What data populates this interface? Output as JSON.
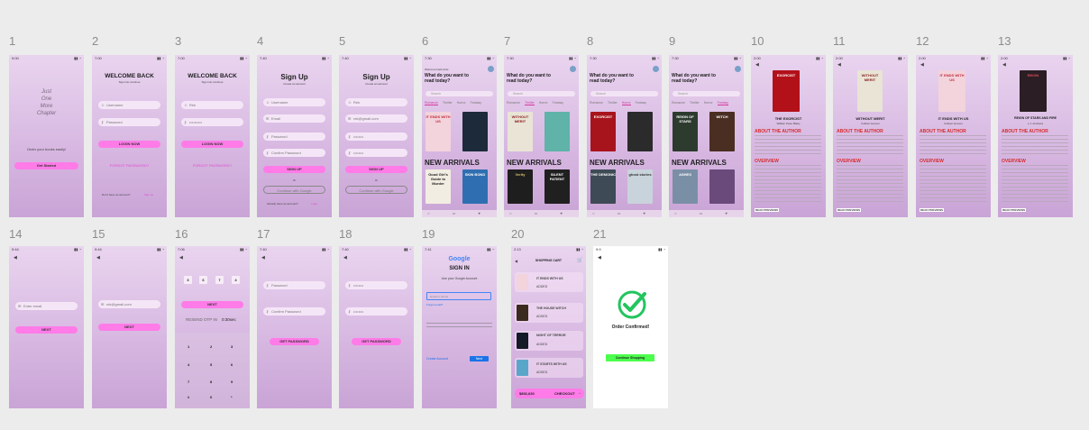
{
  "screens": [
    {
      "num": "1",
      "time": "9:00",
      "tagline": [
        "Just",
        "One",
        "More",
        "Chapter"
      ],
      "prompt": "Order your books easily!",
      "cta": "Get Started"
    },
    {
      "num": "2",
      "time": "7:00",
      "title": "WELCOME BACK",
      "subtitle": "Sign into continue",
      "user_ph": "Username",
      "pass_ph": "Password",
      "login": "LOGIN NOW",
      "forgot": "FORGOT PASSWORD?",
      "signup_q": "Don't have an account?",
      "signup_link": "Sign up"
    },
    {
      "num": "3",
      "time": "7:00",
      "title": "WELCOME BACK",
      "subtitle": "Sign into continue",
      "user_val": "Rek",
      "pass_val": "••••••••••",
      "login": "LOGIN NOW",
      "forgot": "FORGOT PASSWORD?"
    },
    {
      "num": "4",
      "time": "7:40",
      "title": "Sign Up",
      "subtitle": "Create an account",
      "f1": "Username",
      "f2": "Email",
      "f3": "Password",
      "f4": "Confirm Password",
      "signup": "SIGN UP",
      "or": "Or",
      "google": "Continue with Google",
      "have": "Already have an account?",
      "login_link": "Login"
    },
    {
      "num": "5",
      "time": "7:40",
      "title": "Sign Up",
      "subtitle": "Create an account",
      "f1": "Rek",
      "f2": "rek@gmail.com",
      "f3": "••••••••",
      "f4": "••••••••",
      "signup": "SIGN UP",
      "or": "Or",
      "google": "Continue with Google"
    },
    {
      "num": "6",
      "time": "7:30",
      "welcome": "Welcome back Ariel",
      "q1": "What do you want to",
      "q2": "read today?",
      "search": "Search",
      "tabs": [
        "Romance",
        "Thriller",
        "Horror",
        "Fantasy"
      ],
      "new_arrivals": "NEW ARRIVALS"
    },
    {
      "num": "7",
      "time": "7:30",
      "q1": "What do you want to",
      "q2": "read today?",
      "search": "Search",
      "tabs": [
        "Romance",
        "Thriller",
        "Horror",
        "Fantasy"
      ],
      "new_arrivals": "NEW ARRIVALS"
    },
    {
      "num": "8",
      "time": "7:30",
      "q1": "What do you want to",
      "q2": "read today?",
      "search": "Search",
      "tabs": [
        "Romance",
        "Thriller",
        "Horror",
        "Fantasy"
      ],
      "new_arrivals": "NEW ARRIVALS"
    },
    {
      "num": "9",
      "time": "7:30",
      "q1": "What do you want to",
      "q2": "read today?",
      "search": "Search",
      "tabs": [
        "Romance",
        "Thriller",
        "Horror",
        "Fantasy"
      ],
      "new_arrivals": "NEW ARRIVALS"
    },
    {
      "num": "10",
      "time": "2:00",
      "book_title": "THE EXORCIST",
      "author": "William Peter Blatty",
      "about": "ABOUT THE AUTHOR",
      "overview": "OVERVIEW",
      "read": "READ PREVIEWS"
    },
    {
      "num": "11",
      "time": "2:00",
      "book_title": "WITHOUT MERIT",
      "author": "Colleen Hoover",
      "about": "ABOUT THE AUTHOR",
      "overview": "OVERVIEW",
      "read": "READ PREVIEWS"
    },
    {
      "num": "12",
      "time": "2:00",
      "book_title": "IT ENDS WITH US",
      "author": "Colleen Hoover",
      "about": "ABOUT THE AUTHOR",
      "overview": "OVERVIEW",
      "read": "READ PREVIEWS"
    },
    {
      "num": "13",
      "time": "2:00",
      "book_title": "REIGN OF STARS AND FIRE",
      "author": "L.J. Andrews",
      "about": "ABOUT THE AUTHOR",
      "overview": "OVERVIEW",
      "read": "READ PREVIEWS"
    },
    {
      "num": "14",
      "time": "9:44",
      "field": "Enter email",
      "next": "NEXT"
    },
    {
      "num": "15",
      "time": "9:44",
      "field": "rek@gmail.com",
      "next": "NEXT"
    },
    {
      "num": "16",
      "time": "7:06",
      "digits": [
        "3",
        "6",
        "7",
        "4"
      ],
      "next": "NEXT",
      "resend": "RESEND OTP IN",
      "timer": "0:30sec",
      "keys": [
        "1",
        "2",
        "3",
        "4",
        "5",
        "6",
        "7",
        "8",
        "9",
        "#",
        "0",
        "*"
      ]
    },
    {
      "num": "17",
      "time": "7:40",
      "f1": "Password",
      "f2": "Confirm Password",
      "btn": "GET PASSWORD"
    },
    {
      "num": "18",
      "time": "7:40",
      "f1": "••••••••",
      "f2": "••••••••",
      "btn": "GET PASSWORD"
    },
    {
      "num": "19",
      "time": "7:41",
      "brand": "Google",
      "title": "SIGN IN",
      "sub": "Use your Google Account",
      "email_ph": "Email or phone",
      "forgot": "Forgot email?",
      "create": "Create Account",
      "next": "Next"
    },
    {
      "num": "20",
      "time": "2:13",
      "title": "SHOPPING CART",
      "items": [
        {
          "name": "IT ENDS WITH US",
          "status": "ADDED"
        },
        {
          "name": "THE HOUSE WITCH",
          "status": "ADDED"
        },
        {
          "name": "NIGHT OF TERROR",
          "status": "ADDED"
        },
        {
          "name": "IT STARTS WITH US",
          "status": "ADDED"
        }
      ],
      "total": "$892,630",
      "checkout": "CHECKOUT"
    },
    {
      "num": "21",
      "time": "9:9",
      "confirmed": "Order Confirmed!",
      "continue": "Continue Shopping"
    }
  ],
  "covers": {
    "b1": "IT ENDS WITH US",
    "b2": "",
    "b3": "Good Girl's Guide to Murder",
    "b4": "SKIN BOND",
    "b5": "WITHOUT MERIT",
    "b6": "",
    "b7": "Verity",
    "b8": "SILENT PATIENT",
    "b9": "EXORCIST",
    "b10": "",
    "b11": "THE DEMONIC",
    "b12": "ghost stories",
    "b13": "REIGN OF STARS",
    "b14": "WITCH",
    "b15": "ASHES",
    "b16": "",
    "c10": "EXORCIST",
    "c11": "WITHOUT MERIT",
    "c12": "IT ENDS WITH US",
    "c13": "REIGN"
  },
  "colors": {
    "accent": "#ff7be8",
    "link": "#e24bd0",
    "confirm_green": "#22c55e",
    "continue_btn": "#4cff4c"
  }
}
